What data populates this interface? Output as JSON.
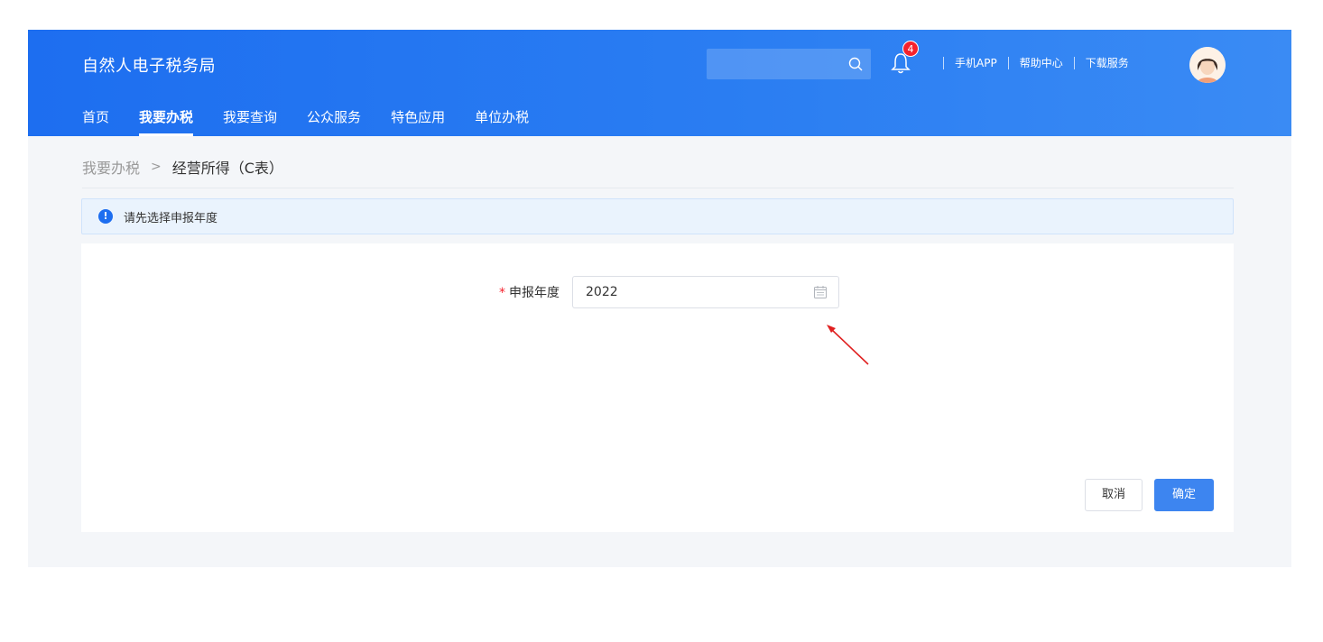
{
  "header": {
    "brand": "自然人电子税务局",
    "search": {
      "placeholder": ""
    },
    "notification_count": "4",
    "links": [
      "手机APP",
      "帮助中心",
      "下载服务"
    ],
    "nav": [
      {
        "label": "首页",
        "active": false
      },
      {
        "label": "我要办税",
        "active": true
      },
      {
        "label": "我要查询",
        "active": false
      },
      {
        "label": "公众服务",
        "active": false
      },
      {
        "label": "特色应用",
        "active": false
      },
      {
        "label": "单位办税",
        "active": false
      }
    ]
  },
  "breadcrumb": {
    "parent": "我要办税",
    "separator": ">",
    "current": "经营所得（C表）"
  },
  "alert": {
    "icon": "!",
    "text": "请先选择申报年度"
  },
  "form": {
    "required_mark": "*",
    "year_label": "申报年度",
    "year_value": "2022"
  },
  "buttons": {
    "cancel": "取消",
    "confirm": "确定"
  },
  "colors": {
    "header": "#1d6ef0",
    "primary": "#3d85f0",
    "alert_bg": "#eaf3fd",
    "required": "#f5222d",
    "annotation_arrow": "#e02020"
  }
}
